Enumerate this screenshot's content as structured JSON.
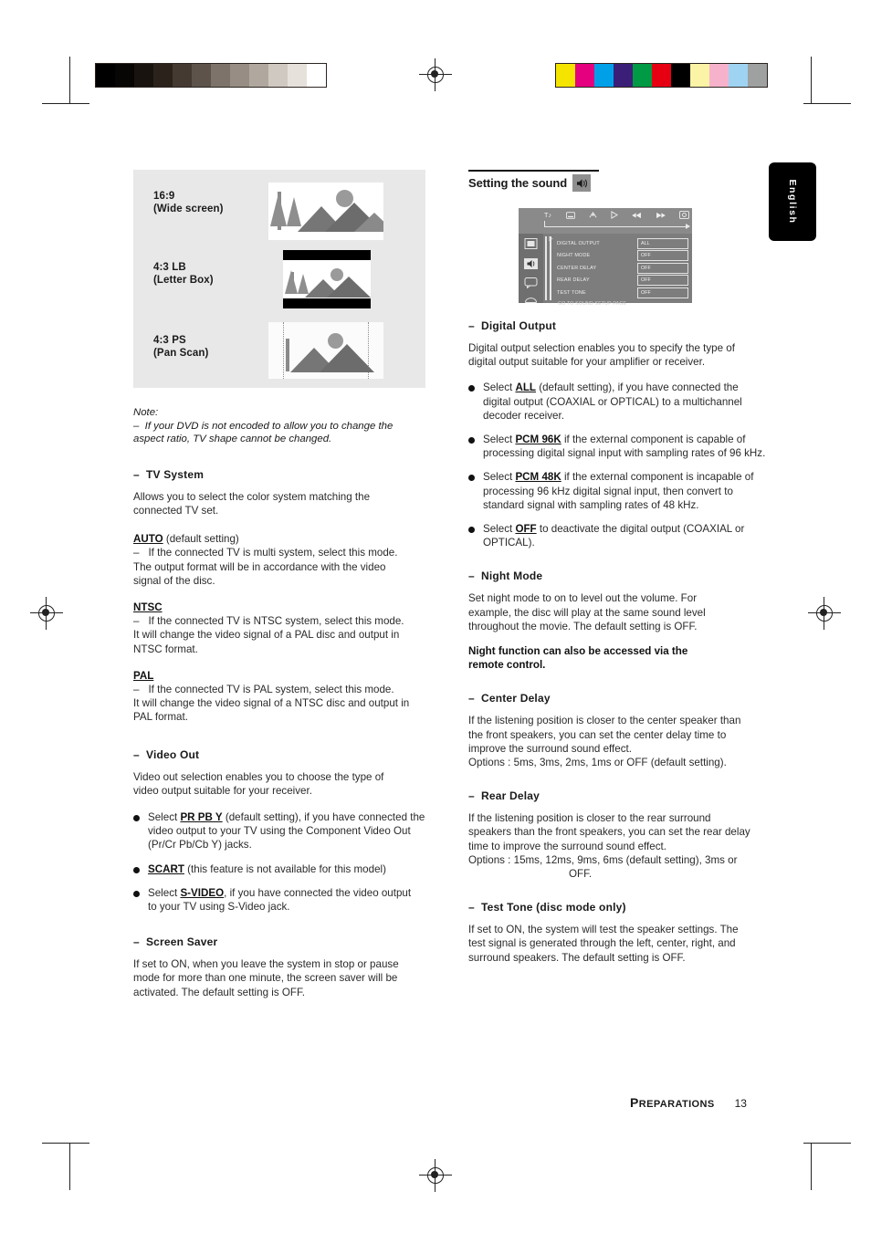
{
  "print_marks": {
    "grayscale_swatches": [
      "#000000",
      "#080604",
      "#191310",
      "#2b221c",
      "#453a32",
      "#5d534b",
      "#7d736b",
      "#978d85",
      "#b0a89f",
      "#cfc9c1",
      "#e6e2db",
      "#ffffff"
    ],
    "color_swatches": [
      "#f5e400",
      "#e4007f",
      "#00a0e9",
      "#3b1e78",
      "#009944",
      "#e60012",
      "#000000",
      "#fbf3a5",
      "#f7b2cb",
      "#9fd3f2",
      "#9fa0a0"
    ]
  },
  "figure": {
    "rows": [
      {
        "label_line1": "16:9",
        "label_line2": "(Wide screen)",
        "type": "wide"
      },
      {
        "label_line1": "4:3 LB",
        "label_line2": "(Letter Box)",
        "type": "letterbox"
      },
      {
        "label_line1": "4:3 PS",
        "label_line2": "(Pan Scan)",
        "type": "panscan"
      }
    ]
  },
  "note": {
    "title": "Note:",
    "line1": "If your DVD is not encoded to allow you to change the",
    "line2": "aspect ratio, TV shape cannot be changed."
  },
  "left_column": {
    "tv_system": {
      "heading": "TV System",
      "intro_line1": "Allows you to select the color system matching the",
      "intro_line2": "connected TV set.",
      "options": [
        {
          "name": "AUTO",
          "suffix": " (default setting)",
          "desc_line1": "If the connected TV is multi system, select this mode.",
          "desc_line2": "The output format will be in accordance with the video",
          "desc_line3": "signal of the disc."
        },
        {
          "name": "NTSC",
          "suffix": "",
          "desc_line1": "If the connected TV is NTSC system, select this mode.",
          "desc_line2": "It will change the video signal of a PAL disc and output in",
          "desc_line3": "NTSC format."
        },
        {
          "name": "PAL",
          "suffix": "",
          "desc_line1": "If the connected TV is PAL system, select this mode.",
          "desc_line2": "It will change the video signal of a NTSC disc and output in",
          "desc_line3": "PAL format."
        }
      ]
    },
    "video_out": {
      "heading": "Video Out",
      "intro_line1": "Video out selection enables you to choose the type of",
      "intro_line2": "video output suitable for your receiver.",
      "bullets": [
        {
          "pre": "Select ",
          "term": "PR PB Y",
          "post_line1": " (default setting), if you have connected the",
          "post_line2": "video output to your TV using the Component Video Out",
          "post_line3": "(Pr/Cr Pb/Cb Y) jacks."
        },
        {
          "pre": "",
          "term": "SCART",
          "post_line1": " (this feature is not available for this model)",
          "post_line2": "",
          "post_line3": ""
        },
        {
          "pre": "Select ",
          "term": "S-VIDEO",
          "post_line1": ", if you have connected the video output",
          "post_line2": "to your TV using S-Video jack.",
          "post_line3": ""
        }
      ]
    },
    "screen_saver": {
      "heading": "Screen Saver",
      "line1": "If set to ON, when you leave the system in stop or pause",
      "line2": "mode for more than one minute, the screen saver will be",
      "line3": "activated. The default setting is OFF."
    }
  },
  "right_column": {
    "heading": "Setting the sound",
    "heading_icon": "speaker-icon",
    "osd": {
      "top_icons": [
        "audio-language-icon",
        "subtitle-icon",
        "angle-icon",
        "play-icon",
        "previous-icon",
        "next-icon",
        "display-icon"
      ],
      "side_icons": [
        "video-setup-icon",
        "sound-setup-icon",
        "language-setup-icon",
        "preference-setup-icon"
      ],
      "rows": [
        {
          "label": "DIGITAL OUTPUT",
          "value": "ALL"
        },
        {
          "label": "NIGHT MODE",
          "value": "OFF"
        },
        {
          "label": "CENTER DELAY",
          "value": "OFF"
        },
        {
          "label": "REAR DELAY",
          "value": "OFF"
        },
        {
          "label": "TEST TONE",
          "value": "OFF"
        }
      ],
      "footer": "GO TO SOUND SETUP PAGE"
    },
    "digital_output": {
      "heading": "Digital Output",
      "intro_line1": "Digital output selection enables you to specify the type of",
      "intro_line2": "digital output suitable for your amplifier or receiver.",
      "bullets": [
        {
          "pre": "Select ",
          "term": "ALL",
          "post_line1": " (default setting), if you have connected the",
          "post_line2": "digital output (COAXIAL or OPTICAL) to a multichannel",
          "post_line3": "decoder receiver."
        },
        {
          "pre": "Select ",
          "term": "PCM 96K",
          "post_line1": " if the external component is capable of",
          "post_line2": "processing digital signal input with sampling rates of 96 kHz.",
          "post_line3": ""
        },
        {
          "pre": "Select ",
          "term": "PCM 48K",
          "post_line1": " if the external component is incapable of",
          "post_line2": "processing 96 kHz digital signal input, then convert to",
          "post_line3": "standard signal with sampling rates of 48 kHz."
        },
        {
          "pre": "Select ",
          "term": "OFF",
          "post_line1": " to deactivate the digital output (COAXIAL or",
          "post_line2": "OPTICAL).",
          "post_line3": ""
        }
      ]
    },
    "night_mode": {
      "heading": "Night Mode",
      "line1": "Set night mode to on to level out the volume.  For",
      "line2": "example, the disc will play at the same sound level",
      "line3": "throughout the movie. The default setting is OFF.",
      "bold_line1": "Night function can also be accessed via the",
      "bold_line2": "remote control."
    },
    "center_delay": {
      "heading": "Center Delay",
      "line1": "If the listening position is closer to the center speaker than",
      "line2": "the front speakers, you can set the center delay time to",
      "line3": "improve the surround sound effect.",
      "line4": "Options : 5ms, 3ms, 2ms, 1ms or OFF (default setting)."
    },
    "rear_delay": {
      "heading": "Rear Delay",
      "line1": "If the listening position is closer to the rear surround",
      "line2": "speakers than the front speakers, you can set the rear delay",
      "line3": "time to improve the surround sound effect.",
      "line4": "Options : 15ms, 12ms, 9ms, 6ms (default setting), 3ms or",
      "line5": "OFF."
    },
    "test_tone": {
      "heading": "Test Tone (disc mode only)",
      "line1": "If set to ON, the system will test the speaker settings.  The",
      "line2": "test signal is generated through the left, center, right, and",
      "line3": "surround speakers. The default setting is OFF."
    }
  },
  "side_tab": {
    "label": "English"
  },
  "footer": {
    "section_first": "P",
    "section_rest": "REPARATIONS",
    "page_number": "13"
  }
}
